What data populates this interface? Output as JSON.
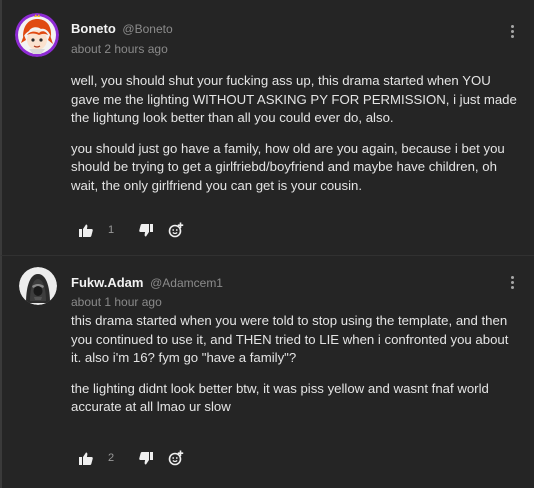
{
  "comments": [
    {
      "author": "Boneto",
      "handle": "@Boneto",
      "time": "about 2 hours ago",
      "paragraphs": [
        "well, you should shut your fucking ass up, this drama started when YOU gave me the lighting WITHOUT ASKING PY FOR PERMISSION, i just made the lightung look better than all you could ever do, also.",
        "you should just go have a family, how old are you again, because i bet you should be trying to get a girlfriebd/boyfriend and maybe have children, oh wait, the only girlfriend you can get is your cousin."
      ],
      "likes": "1",
      "avatar_icon": "orange-haired-character-avatar"
    },
    {
      "author": "Fukw.Adam",
      "handle": "@Adamcem1",
      "time": "about 1 hour ago",
      "paragraphs": [
        "this drama started when you were told to stop using the template, and then you continued to use it, and THEN tried to LIE when i confronted you about it. also i'm 16? fym go \"have a family\"?",
        "",
        "the lighting didnt look better btw, it was piss yellow and wasnt fnaf world accurate at all lmao ur slow"
      ],
      "likes": "2",
      "avatar_icon": "hooded-figure-avatar"
    }
  ],
  "icons": {
    "like": "thumbs-up-icon",
    "dislike": "thumbs-down-icon",
    "react": "add-reaction-icon",
    "menu": "more-options-icon"
  },
  "colors": {
    "background": "#252525",
    "text": "#e4e4e4",
    "muted": "#8a8a8a",
    "avatar_ring": "#8e2bd4"
  }
}
